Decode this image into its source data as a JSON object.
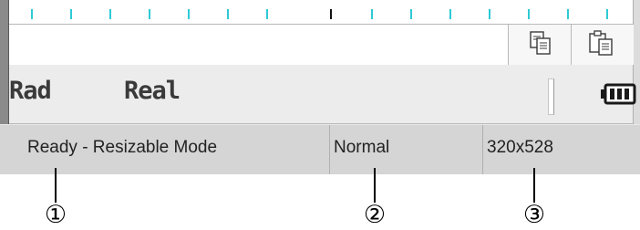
{
  "mode_bar": {
    "angle_mode": "Rad",
    "number_mode": "Real"
  },
  "toolbar": {
    "copy_icon": "copy-icon",
    "paste_icon": "paste-icon"
  },
  "status_bar": {
    "status_text": "Ready - Resizable Mode",
    "view_mode": "Normal",
    "window_size": "320x528"
  },
  "callouts": {
    "status_marker": "①",
    "view_marker": "②",
    "size_marker": "③"
  },
  "colors": {
    "ruler_tick": "#2ec9d6",
    "cursor_tick": "#111111",
    "status_bar_bg": "#d5d5d5",
    "mode_bar_bg": "#ececec"
  },
  "icons": {
    "battery": "battery-icon"
  }
}
